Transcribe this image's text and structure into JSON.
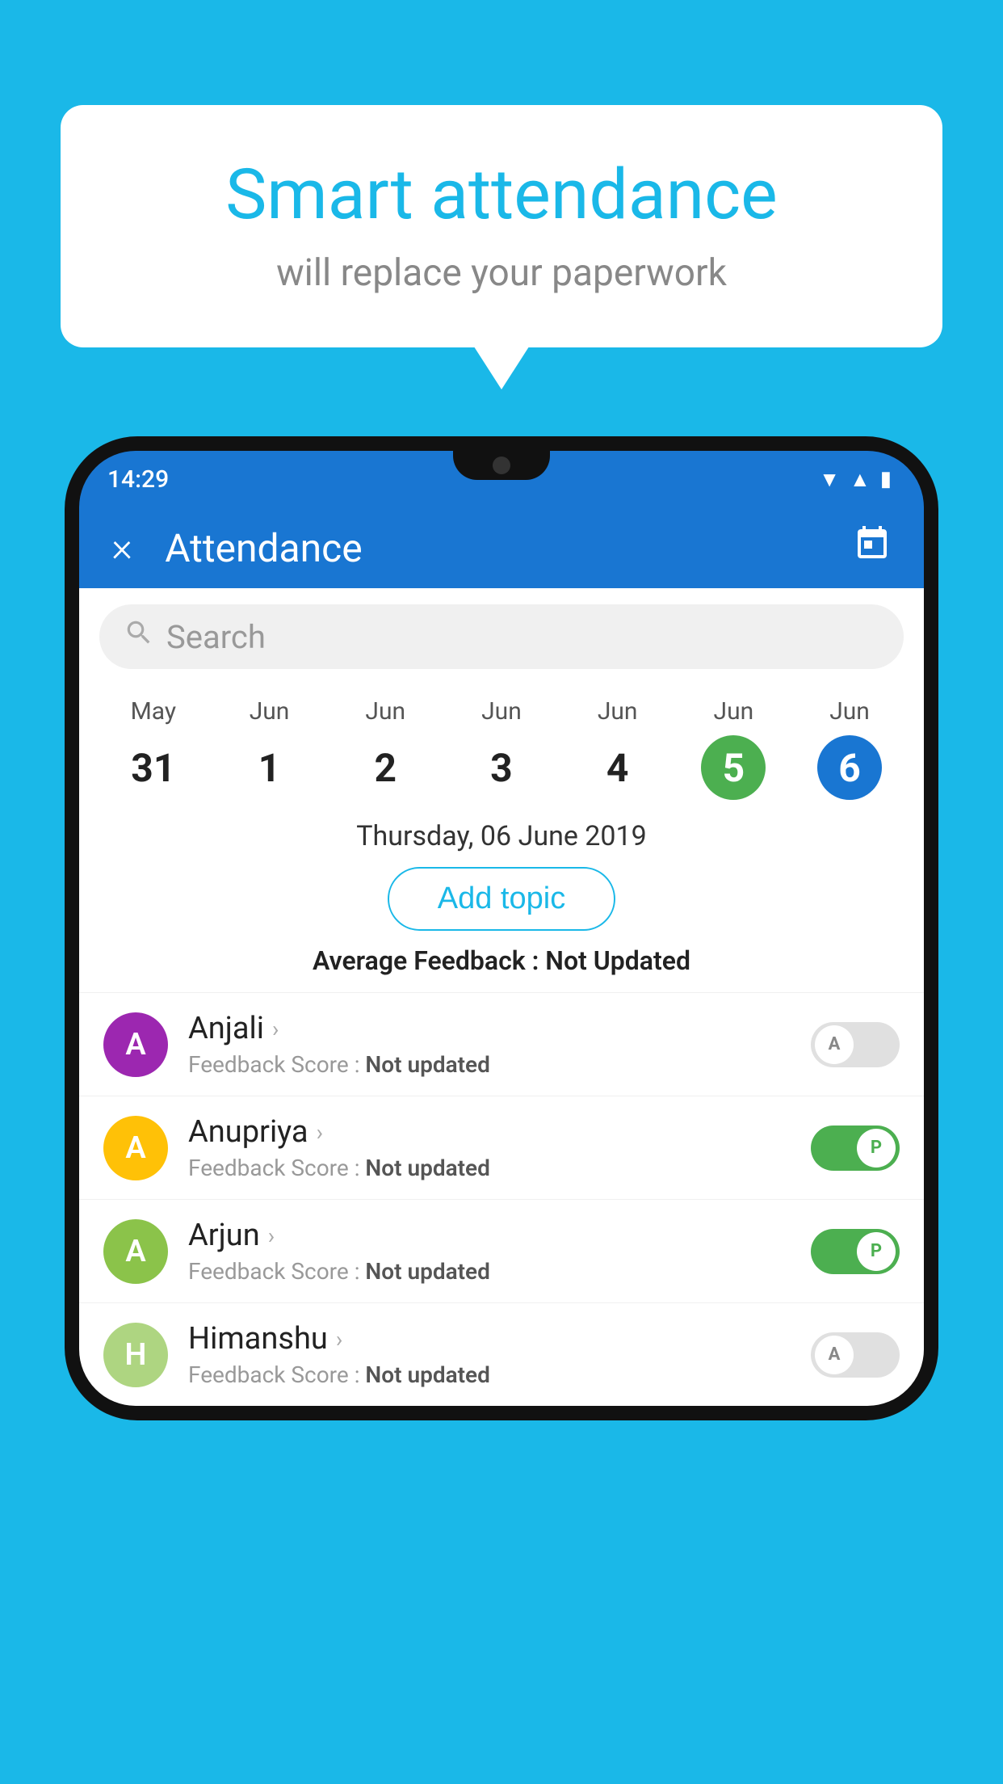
{
  "background_color": "#1ab8e8",
  "bubble": {
    "title": "Smart attendance",
    "subtitle": "will replace your paperwork"
  },
  "status_bar": {
    "time": "14:29",
    "icons": [
      "wifi",
      "signal",
      "battery"
    ]
  },
  "app_header": {
    "close_label": "×",
    "title": "Attendance",
    "calendar_icon": "📅"
  },
  "search": {
    "placeholder": "Search"
  },
  "dates": [
    {
      "month": "May",
      "day": "31",
      "state": "normal"
    },
    {
      "month": "Jun",
      "day": "1",
      "state": "normal"
    },
    {
      "month": "Jun",
      "day": "2",
      "state": "normal"
    },
    {
      "month": "Jun",
      "day": "3",
      "state": "normal"
    },
    {
      "month": "Jun",
      "day": "4",
      "state": "normal"
    },
    {
      "month": "Jun",
      "day": "5",
      "state": "today"
    },
    {
      "month": "Jun",
      "day": "6",
      "state": "selected"
    }
  ],
  "selected_date_label": "Thursday, 06 June 2019",
  "add_topic_label": "Add topic",
  "avg_feedback_label": "Average Feedback :",
  "avg_feedback_value": "Not Updated",
  "students": [
    {
      "name": "Anjali",
      "initial": "A",
      "avatar_color": "#9c27b0",
      "feedback_label": "Feedback Score :",
      "feedback_value": "Not updated",
      "attendance": "absent",
      "toggle_label": "A"
    },
    {
      "name": "Anupriya",
      "initial": "A",
      "avatar_color": "#ffc107",
      "feedback_label": "Feedback Score :",
      "feedback_value": "Not updated",
      "attendance": "present",
      "toggle_label": "P"
    },
    {
      "name": "Arjun",
      "initial": "A",
      "avatar_color": "#8bc34a",
      "feedback_label": "Feedback Score :",
      "feedback_value": "Not updated",
      "attendance": "present",
      "toggle_label": "P"
    },
    {
      "name": "Himanshu",
      "initial": "H",
      "avatar_color": "#aed581",
      "feedback_label": "Feedback Score :",
      "feedback_value": "Not updated",
      "attendance": "absent",
      "toggle_label": "A"
    }
  ]
}
